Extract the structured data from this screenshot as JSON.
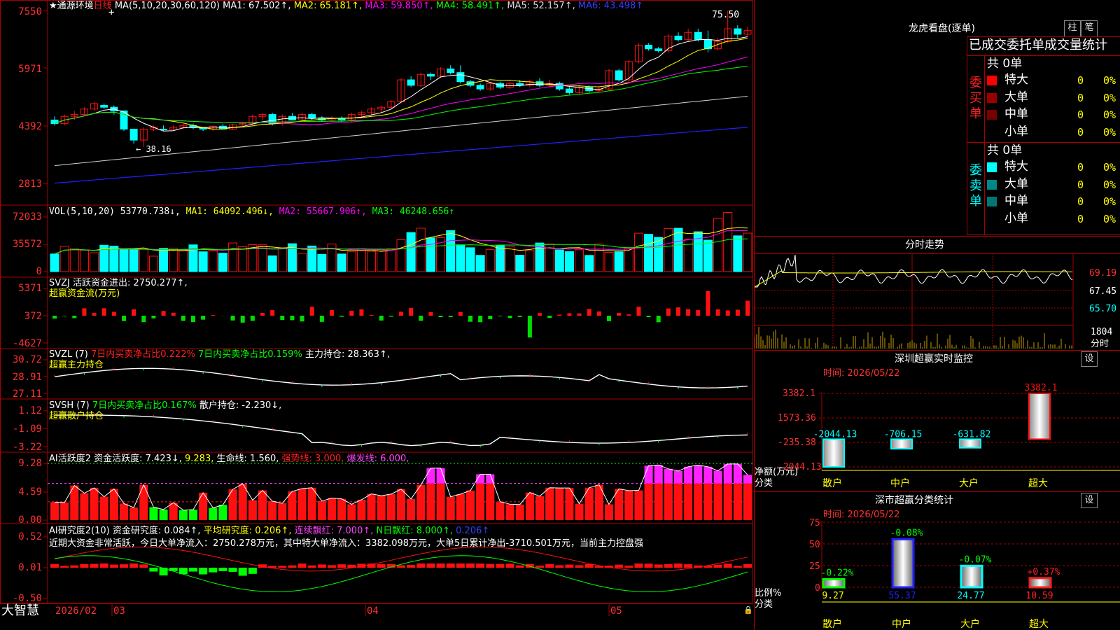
{
  "colors": {
    "up": "#ff1010",
    "down": "#00ffff",
    "grid": "#aa0000",
    "ma1": "#ffffff",
    "ma2": "#ffff00",
    "ma3": "#ff00ff",
    "ma4": "#00ff00",
    "ma5": "#d0d0d0",
    "ma6": "#2020ff",
    "text_white": "#ffffff",
    "text_yellow": "#ffff00",
    "text_green": "#00ff00",
    "text_magenta": "#ff44ff",
    "text_red": "#ff2020",
    "accent_cyan": "#00ffff"
  },
  "main": {
    "title_prefix": "★",
    "stock_name": "通源环境",
    "period": "日线",
    "ma_params": "MA(5,10,20,30,60,120)",
    "ma1": "MA1: 67.502↑,",
    "ma2": "MA2: 65.181↑,",
    "ma3": "MA3: 59.850↑,",
    "ma4": "MA4: 58.491↑,",
    "ma5": "MA5: 52.157↑,",
    "ma6": "MA6: 43.498↑",
    "high_label": "75.50",
    "low_label": "← 38.16",
    "yticks": [
      "7550",
      "5971",
      "4392",
      "2813"
    ]
  },
  "vol": {
    "header": "VOL(5,10,20)",
    "v": "53770.738↓,",
    "ma1": "MA1: 64092.496↓,",
    "ma2": "MA2: 55667.906↑,",
    "ma3": "MA3: 46248.656↑",
    "yticks": [
      "72033",
      "35572",
      "0"
    ]
  },
  "svzj": {
    "header": "SVZJ  活跃资金进出: 2750.277↑,",
    "sub": "超赢资金流(万元)",
    "yticks": [
      "5371",
      "372",
      "-4627"
    ]
  },
  "svzl": {
    "header1": "SVZL (7)",
    "h2": "7日内买卖净占比0.222%",
    "h3": "7日内买卖净占比0.159%",
    "h4": "主力持仓: 28.363↑,",
    "sub": "超赢主力持仓",
    "yticks": [
      "30.72",
      "28.91",
      "27.11"
    ]
  },
  "svsh": {
    "header1": "SVSH (7)",
    "h2": "7日内买卖净占比0.167%",
    "h3": "散户持仓: -2.230↓,",
    "sub": "超赢散户持仓",
    "yticks": [
      "1.12",
      "-1.09",
      "-3.22"
    ]
  },
  "ai1": {
    "header1": "AI活跃度2 资金活跃度: 7.423↓,",
    "h2": "9.283,",
    "h3": "生命线: 1.560,",
    "h4": "强势线: 3.000,",
    "h5": "爆发线: 6.000,",
    "yticks": [
      "9.28",
      "4.59",
      "0.00"
    ]
  },
  "ai2": {
    "header1": "AI研究度2(10) 资金研究度: 0.084↑,",
    "h2": "平均研究度: 0.206↑,",
    "h3": "连续飘红: 7.000↑,",
    "h4": "N日飘红: 8.000↑,",
    "h5": "0.206↑",
    "comment": "近期大资金非常活跃，今日大单净流入：2750.278万元，其中特大单净流入：3382.098万元，大单5日累计净出-3710.501万元，当前主力控盘强",
    "yticks": [
      "0.52",
      "0.01",
      "-0.50"
    ]
  },
  "xaxis": {
    "brand": "大智慧",
    "labels": [
      "2026/02",
      "03",
      "04",
      "05"
    ]
  },
  "dragon": {
    "title": "龙虎看盘(逐单)",
    "btn1": "柱",
    "btn2": "笔",
    "heading": "已成交委托单成交量统计",
    "buy_label": "委买单",
    "sell_label": "委卖单",
    "buy_total": "共 0单",
    "sell_total": "共 0单",
    "buy_rows": [
      {
        "label": "特大",
        "v": "0",
        "p": "0%",
        "c": "#ff0000"
      },
      {
        "label": "大单",
        "v": "0",
        "p": "0%",
        "c": "#990000"
      },
      {
        "label": "中单",
        "v": "0",
        "p": "0%",
        "c": "#770000"
      },
      {
        "label": "小单",
        "v": "0",
        "p": "0%",
        "c": ""
      }
    ],
    "sell_rows": [
      {
        "label": "特大",
        "v": "0",
        "p": "0%",
        "c": "#00ffff"
      },
      {
        "label": "大单",
        "v": "0",
        "p": "0%",
        "c": "#008888"
      },
      {
        "label": "中单",
        "v": "0",
        "p": "0%",
        "c": "#007777"
      },
      {
        "label": "小单",
        "v": "0",
        "p": "0%",
        "c": ""
      }
    ]
  },
  "fenshi": {
    "title": "分时走势",
    "yticks": [
      "69.19",
      "67.45",
      "65.70"
    ],
    "vol_tick": "1804",
    "vol_unit": "分时"
  },
  "sz_monitor": {
    "title": "深圳超赢实时监控",
    "btn": "设",
    "date": "时间: 2026/05/22",
    "yticks": [
      "3382.1",
      "1573.36",
      "-235.38",
      "-2044.13"
    ],
    "bars": [
      {
        "cat": "散户",
        "value": -2044.13,
        "label": "-2044.13"
      },
      {
        "cat": "中户",
        "value": -706.15,
        "label": "-706.15"
      },
      {
        "cat": "大户",
        "value": -631.82,
        "label": "-631.82"
      },
      {
        "cat": "超大",
        "value": 3382.1,
        "label": "3382.1"
      }
    ],
    "ylabel": "净额(万元)",
    "xlabel": "分类"
  },
  "sz_class": {
    "title": "深市超赢分类统计",
    "btn": "设",
    "date": "时间: 2026/05/22",
    "yticks": [
      "75",
      "50",
      "25",
      "0"
    ],
    "bars": [
      {
        "cat": "散户",
        "value": 9.27,
        "change": "-0.22%"
      },
      {
        "cat": "中户",
        "value": 55.37,
        "change": "-0.08%"
      },
      {
        "cat": "大户",
        "value": 24.77,
        "change": "-0.07%"
      },
      {
        "cat": "超大",
        "value": 10.59,
        "change": "+0.37%"
      }
    ],
    "ylabel": "比例%",
    "xlabel": "分类"
  },
  "chart_data": [
    {
      "type": "candlestick",
      "title": "通源环境 日线",
      "ylim": [
        2813,
        7550
      ],
      "x_labels": [
        "2026/02",
        "03",
        "04",
        "05"
      ],
      "ma_last": {
        "MA1": 67.502,
        "MA2": 65.181,
        "MA3": 59.85,
        "MA4": 58.491,
        "MA5": 52.157,
        "MA6": 43.498
      },
      "high": 75.5,
      "low": 38.16,
      "ohlc": [
        [
          4550,
          4650,
          4400,
          4450
        ],
        [
          4450,
          4700,
          4400,
          4650
        ],
        [
          4650,
          4800,
          4550,
          4700
        ],
        [
          4700,
          4900,
          4650,
          4850
        ],
        [
          4850,
          5050,
          4800,
          5000
        ],
        [
          4950,
          5000,
          4850,
          4900
        ],
        [
          4900,
          4950,
          4700,
          4800
        ],
        [
          4800,
          4800,
          4250,
          4300
        ],
        [
          4300,
          4300,
          3900,
          4000
        ],
        [
          4000,
          4350,
          3816,
          4300
        ],
        [
          4300,
          4400,
          4250,
          4350
        ],
        [
          4300,
          4400,
          4250,
          4280
        ],
        [
          4280,
          4400,
          4250,
          4350
        ],
        [
          4350,
          4450,
          4300,
          4400
        ],
        [
          4400,
          4450,
          4300,
          4350
        ],
        [
          4350,
          4350,
          4250,
          4300
        ],
        [
          4300,
          4400,
          4250,
          4380
        ],
        [
          4380,
          4450,
          4300,
          4300
        ],
        [
          4300,
          4450,
          4280,
          4420
        ],
        [
          4420,
          4500,
          4350,
          4450
        ],
        [
          4450,
          4700,
          4400,
          4650
        ],
        [
          4650,
          4750,
          4550,
          4700
        ],
        [
          4700,
          4750,
          4400,
          4450
        ],
        [
          4450,
          4700,
          4400,
          4650
        ],
        [
          4650,
          4750,
          4550,
          4550
        ],
        [
          4550,
          4750,
          4500,
          4700
        ],
        [
          4700,
          4750,
          4550,
          4600
        ],
        [
          4600,
          4650,
          4500,
          4550
        ],
        [
          4550,
          4650,
          4500,
          4600
        ],
        [
          4600,
          4650,
          4500,
          4550
        ],
        [
          4550,
          4750,
          4500,
          4700
        ],
        [
          4700,
          4800,
          4600,
          4750
        ],
        [
          4750,
          4900,
          4700,
          4850
        ],
        [
          4850,
          4950,
          4750,
          4900
        ],
        [
          4900,
          5100,
          4850,
          5050
        ],
        [
          5050,
          5700,
          5000,
          5650
        ],
        [
          5650,
          5750,
          5450,
          5500
        ],
        [
          5500,
          5850,
          5450,
          5800
        ],
        [
          5800,
          5850,
          5650,
          5750
        ],
        [
          5750,
          6000,
          5700,
          5950
        ],
        [
          5950,
          6050,
          5800,
          5850
        ],
        [
          5850,
          6050,
          5550,
          5600
        ],
        [
          5600,
          5650,
          5450,
          5500
        ],
        [
          5500,
          5550,
          5350,
          5400
        ],
        [
          5400,
          5600,
          5350,
          5550
        ],
        [
          5550,
          5600,
          5400,
          5450
        ],
        [
          5450,
          5600,
          5400,
          5550
        ],
        [
          5550,
          5650,
          5450,
          5500
        ],
        [
          5500,
          5650,
          5450,
          5600
        ],
        [
          5600,
          5700,
          5450,
          5500
        ],
        [
          5500,
          5650,
          5450,
          5550
        ],
        [
          5550,
          5600,
          5350,
          5400
        ],
        [
          5400,
          5450,
          5250,
          5300
        ],
        [
          5300,
          5500,
          5250,
          5450
        ],
        [
          5450,
          5500,
          5300,
          5350
        ],
        [
          5350,
          5450,
          5300,
          5400
        ],
        [
          5400,
          5950,
          5350,
          5900
        ],
        [
          5900,
          5950,
          5600,
          5650
        ],
        [
          5650,
          6200,
          5600,
          6150
        ],
        [
          6150,
          6650,
          6100,
          6600
        ],
        [
          6600,
          6650,
          6450,
          6500
        ],
        [
          6500,
          6550,
          6400,
          6450
        ],
        [
          6450,
          6900,
          6400,
          6850
        ],
        [
          6850,
          6950,
          6700,
          6750
        ],
        [
          6750,
          7050,
          6700,
          6950
        ],
        [
          6950,
          7050,
          6700,
          6750
        ],
        [
          6750,
          7000,
          6400,
          6500
        ],
        [
          6500,
          6800,
          6450,
          6700
        ],
        [
          6700,
          7550,
          6650,
          7050
        ],
        [
          7050,
          7150,
          6800,
          6900
        ],
        [
          6900,
          7100,
          6850,
          7000
        ]
      ]
    },
    {
      "type": "bar",
      "title": "VOL(5,10,20)",
      "ylim": [
        0,
        72033
      ],
      "last": 53770.738,
      "ma_last": {
        "MA1": 64092.496,
        "MA2": 55667.906,
        "MA3": 46248.656
      }
    },
    {
      "type": "bar",
      "title": "SVZJ 活跃资金进出",
      "unit": "万元",
      "last": 2750.277,
      "ylim": [
        -4627,
        5371
      ]
    },
    {
      "type": "line",
      "title": "SVZL 主力持仓",
      "last": 28.363,
      "ylim": [
        27.11,
        30.72
      ]
    },
    {
      "type": "line",
      "title": "SVSH 散户持仓",
      "last": -2.23,
      "ylim": [
        -3.22,
        1.12
      ]
    },
    {
      "type": "bar",
      "title": "AI活跃度2",
      "last": 7.423,
      "ylim": [
        0,
        9.28
      ],
      "lines": {
        "生命线": 1.56,
        "强势线": 3.0,
        "爆发线": 6.0
      }
    },
    {
      "type": "bar",
      "title": "AI研究度2(10)",
      "last": 0.084,
      "ylim": [
        -0.5,
        0.52
      ]
    },
    {
      "type": "bar",
      "title": "深圳超赢实时监控",
      "categories": [
        "散户",
        "中户",
        "大户",
        "超大"
      ],
      "values": [
        -2044.13,
        -706.15,
        -631.82,
        3382.1
      ],
      "ylabel": "净额(万元)",
      "xlabel": "分类"
    },
    {
      "type": "bar",
      "title": "深市超赢分类统计",
      "categories": [
        "散户",
        "中户",
        "大户",
        "超大"
      ],
      "values": [
        9.27,
        55.37,
        24.77,
        10.59
      ],
      "ylabel": "比例%",
      "xlabel": "分类"
    }
  ]
}
